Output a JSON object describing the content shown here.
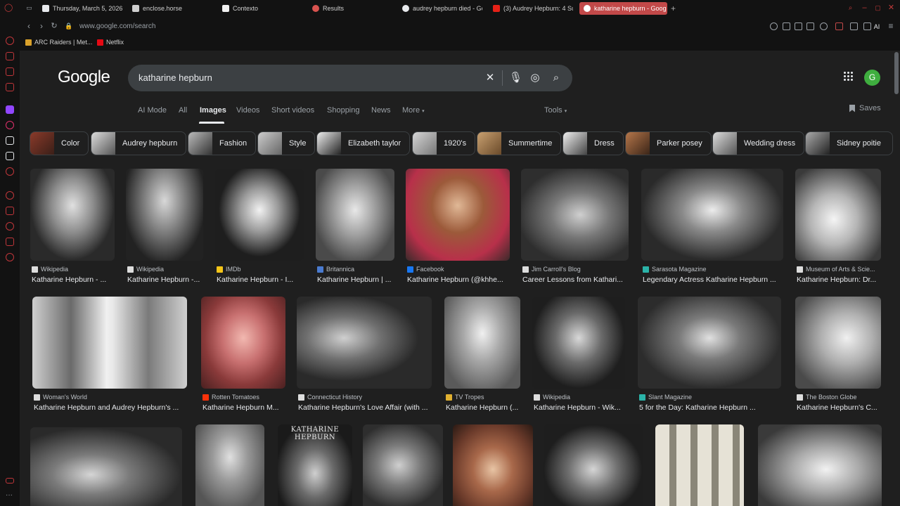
{
  "browser": {
    "tabs": [
      {
        "label": "Thursday, March 5, 2026",
        "icon": "calendar-icon",
        "active": false
      },
      {
        "label": "enclose.horse",
        "icon": "horse-icon",
        "active": false
      },
      {
        "label": "Contexto",
        "icon": "contexto-icon",
        "active": false
      },
      {
        "label": "Results",
        "icon": "results-icon",
        "active": false
      },
      {
        "label": "audrey hepburn died - Go",
        "icon": "google-icon",
        "active": false
      },
      {
        "label": "(3) Audrey Hepburn: 4 Su",
        "icon": "youtube-icon",
        "active": false
      },
      {
        "label": "katharine hepburn - Goog",
        "icon": "google-icon",
        "active": true
      }
    ],
    "new_tab": "+",
    "url": "www.google.com/search",
    "bookmarks": [
      {
        "label": "ARC Raiders | Met...",
        "color": "#d9a12b"
      },
      {
        "label": "Netflix",
        "color": "#e50914"
      }
    ],
    "accent": "#c24949"
  },
  "google": {
    "logo": "Google",
    "search_value": "katharine hepburn",
    "account_initial": "G",
    "account_color": "#3fae3f",
    "tabs": [
      "AI Mode",
      "All",
      "Images",
      "Videos",
      "Short videos",
      "Shopping",
      "News",
      "More"
    ],
    "active_tab": "Images",
    "tools": "Tools",
    "saves": "Saves",
    "chips": [
      "Color",
      "Audrey hepburn",
      "Fashion",
      "Style",
      "Elizabeth taylor",
      "1920's",
      "Summertime",
      "Dress",
      "Parker posey",
      "Wedding dress",
      "Sidney poitie"
    ]
  },
  "results": {
    "row1": [
      {
        "source": "Wikipedia",
        "title": "Katharine Hepburn - ..."
      },
      {
        "source": "Wikipedia",
        "title": "Katharine Hepburn -..."
      },
      {
        "source": "IMDb",
        "title": "Katharine Hepburn - I..."
      },
      {
        "source": "Britannica",
        "title": "Katharine Hepburn | ..."
      },
      {
        "source": "Facebook",
        "title": "Katharine Hepburn (@khhe..."
      },
      {
        "source": "Jim Carroll's Blog",
        "title": "Career Lessons from Kathari..."
      },
      {
        "source": "Sarasota Magazine",
        "title": "Legendary Actress Katharine Hepburn ..."
      },
      {
        "source": "Museum of Arts & Scie...",
        "title": "Katharine Hepburn: Dr..."
      }
    ],
    "row2": [
      {
        "source": "Woman's World",
        "title": "Katharine Hepburn and Audrey Hepburn's ..."
      },
      {
        "source": "Rotten Tomatoes",
        "title": "Katharine Hepburn M..."
      },
      {
        "source": "Connecticut History",
        "title": "Katharine Hepburn's Love Affair (with ..."
      },
      {
        "source": "TV Tropes",
        "title": "Katharine Hepburn (..."
      },
      {
        "source": "Wikipedia",
        "title": "Katharine Hepburn - Wik..."
      },
      {
        "source": "Slant Magazine",
        "title": "5 for the Day: Katharine Hepburn ..."
      },
      {
        "source": "The Boston Globe",
        "title": "Katharine Hepburn's C..."
      }
    ],
    "row3_caption": "KATHARINE HEPBURN"
  }
}
